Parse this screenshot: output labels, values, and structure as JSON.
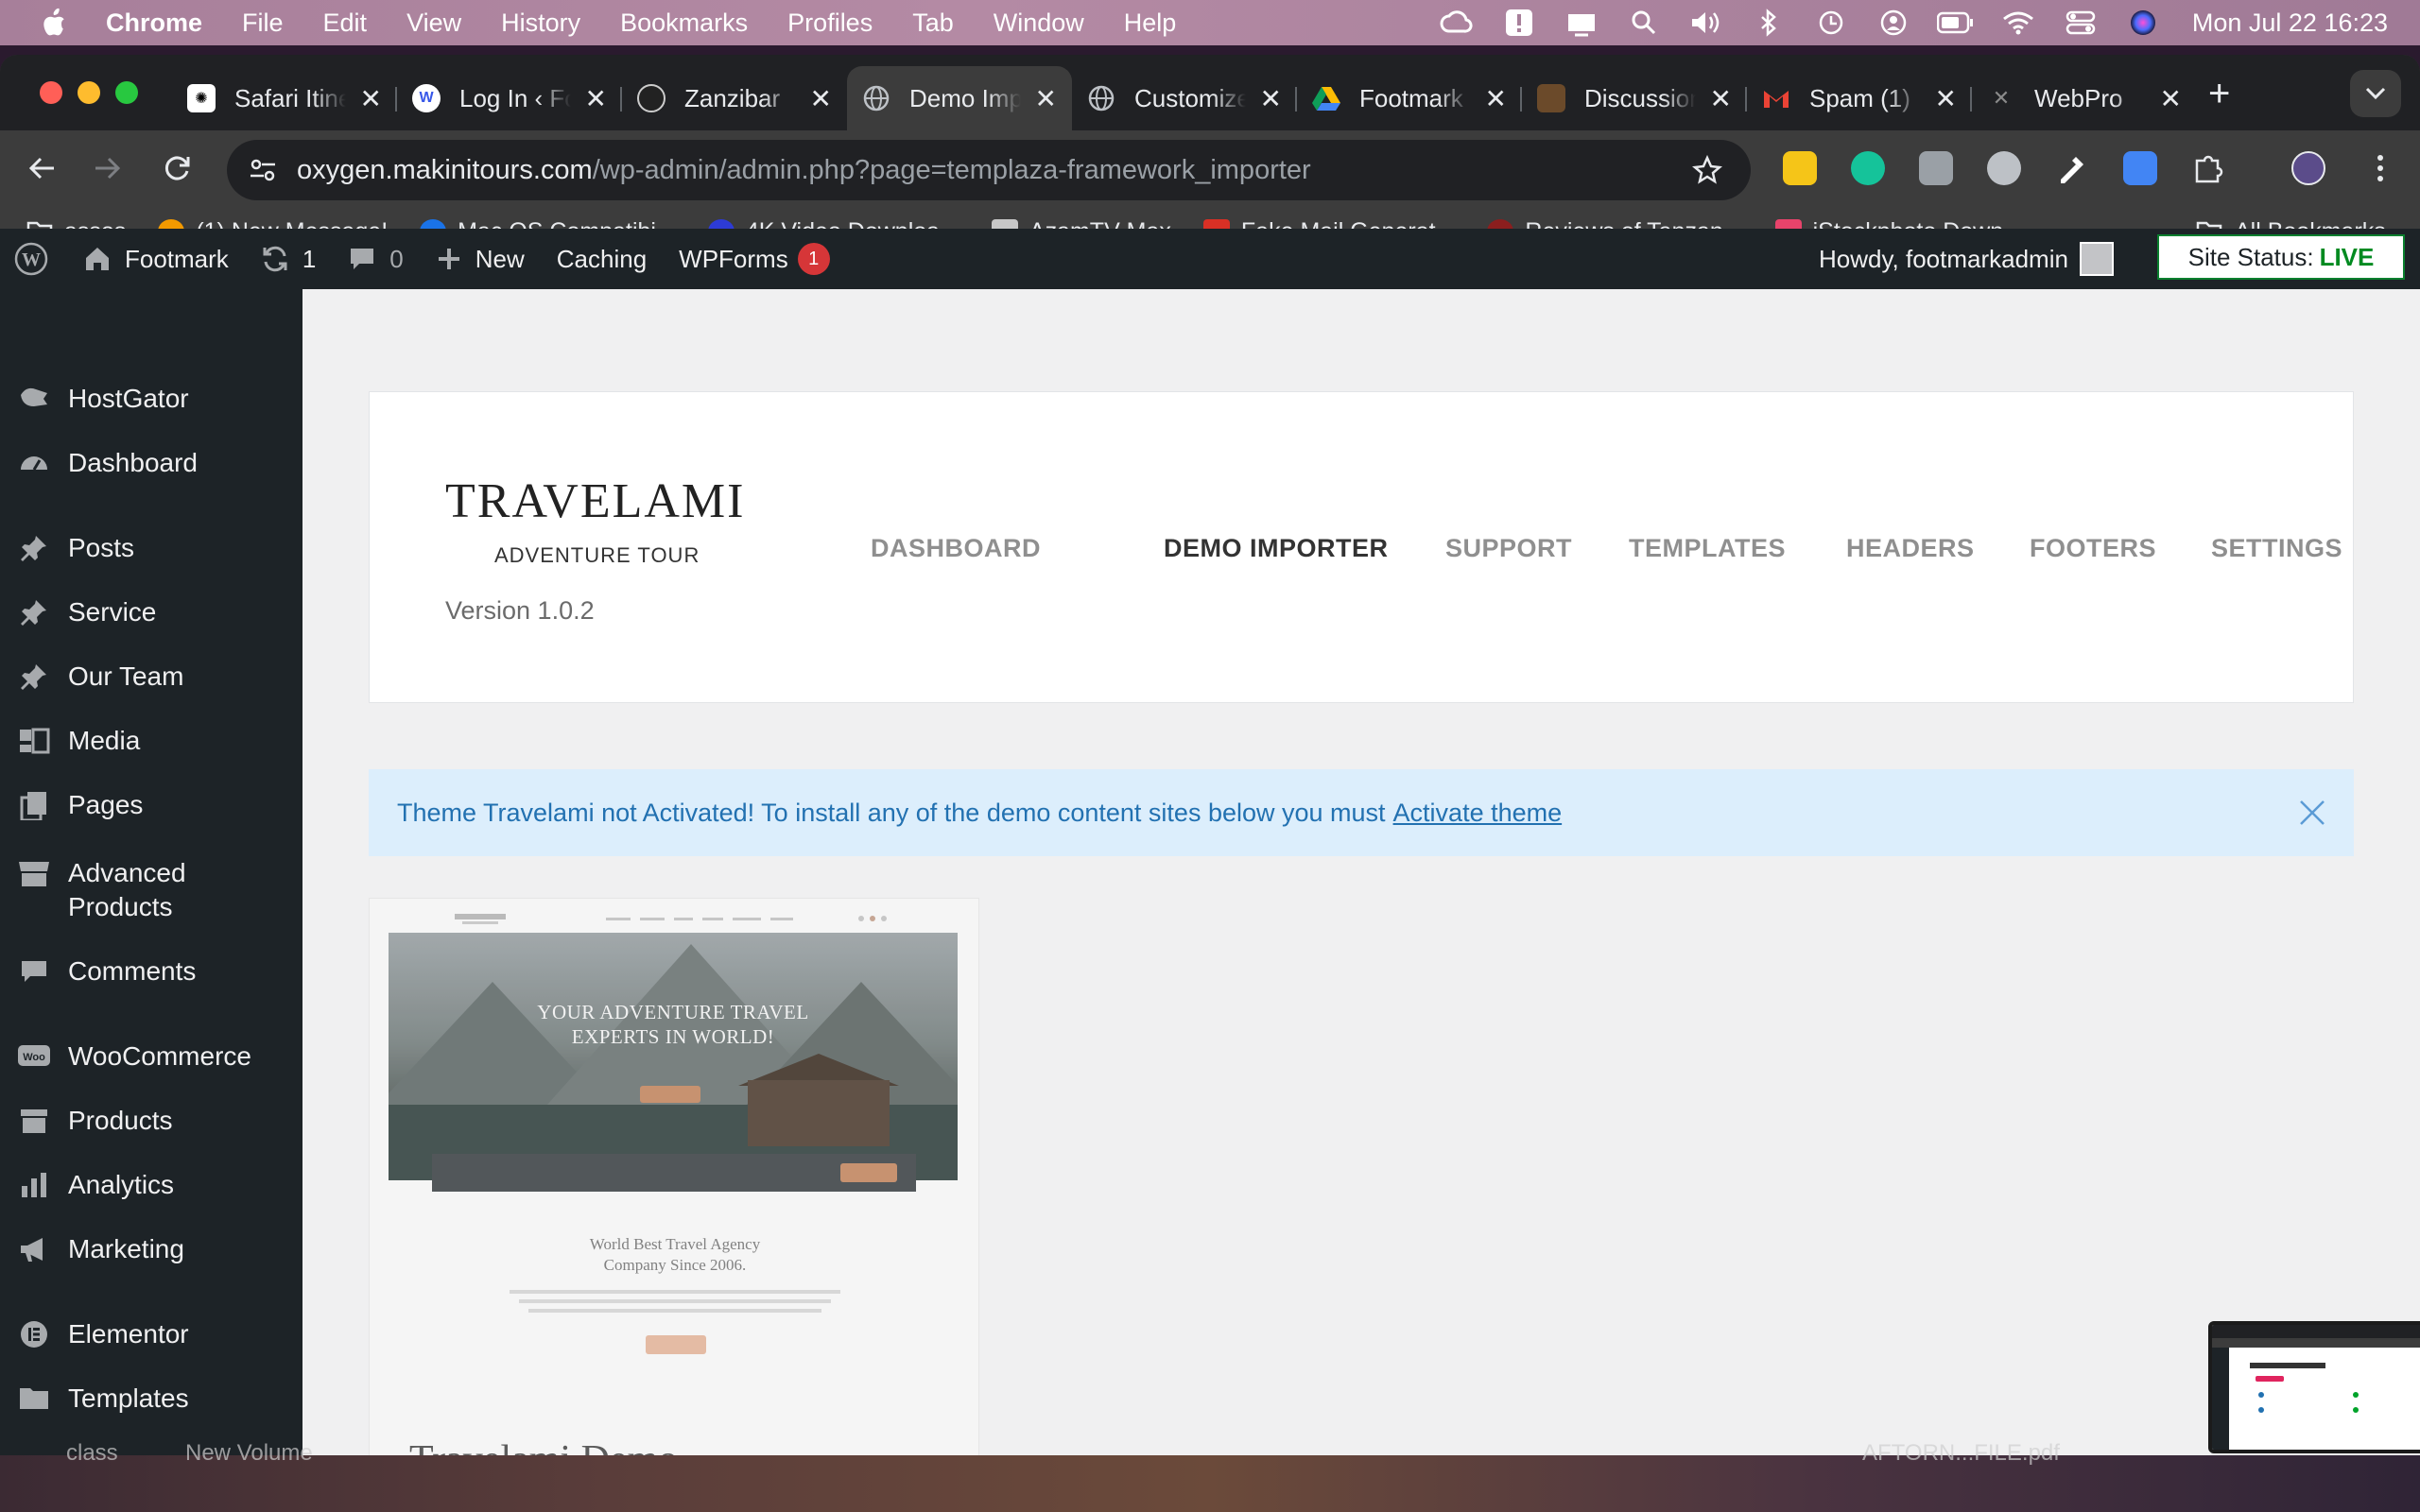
{
  "menubar": {
    "app": "Chrome",
    "items": [
      "File",
      "Edit",
      "View",
      "History",
      "Bookmarks",
      "Profiles",
      "Tab",
      "Window",
      "Help"
    ],
    "clock": "Mon Jul 22  16:23"
  },
  "tabs": [
    {
      "title": "Safari Itinerary",
      "icon": "chatgpt-icon"
    },
    {
      "title": "Log In ‹ Footmark",
      "icon": "wordpress-icon"
    },
    {
      "title": "Zanzibar",
      "icon": "zanzibar-icon"
    },
    {
      "title": "Demo Importer",
      "icon": "globe-icon",
      "active": true
    },
    {
      "title": "Customize",
      "icon": "globe-icon"
    },
    {
      "title": "Footmark",
      "icon": "drive-icon"
    },
    {
      "title": "Discussion",
      "icon": "book-icon"
    },
    {
      "title": "Spam (1)",
      "icon": "gmail-icon"
    },
    {
      "title": "WebPro",
      "icon": "webpro-icon"
    }
  ],
  "url": {
    "host": "oxygen.makinitours.com",
    "path": "/wp-admin/admin.php?page=templaza-framework_importer"
  },
  "bookmarks": [
    {
      "label": "assos",
      "icon": "folder-icon"
    },
    {
      "label": "(1) New Message!",
      "icon": "play-icon"
    },
    {
      "label": "Mac OS Compatibi...",
      "icon": "cloud-icon"
    },
    {
      "label": "4K Video Downloa...",
      "icon": "info-icon"
    },
    {
      "label": "AzamTV Max",
      "icon": "tv-icon"
    },
    {
      "label": "Fake Mail Generat...",
      "icon": "mail-icon"
    },
    {
      "label": "Reviews of Tanzan...",
      "icon": "tripadvisor-icon"
    },
    {
      "label": "iStockphoto Down...",
      "icon": "download-icon"
    }
  ],
  "bookmarks_all": "All Bookmarks",
  "adminbar": {
    "site": "Footmark",
    "updates": "1",
    "comments": "0",
    "new": "New",
    "caching": "Caching",
    "wpforms": "WPForms",
    "wpforms_badge": "1",
    "howdy": "Howdy, footmarkadmin",
    "status_label": "Site Status:",
    "status_value": "LIVE"
  },
  "sidebar": [
    {
      "label": "HostGator",
      "icon": "hostgator-icon"
    },
    {
      "label": "Dashboard",
      "icon": "dashboard-icon"
    },
    {
      "label": "Posts",
      "icon": "pin-icon"
    },
    {
      "label": "Service",
      "icon": "pin-icon"
    },
    {
      "label": "Our Team",
      "icon": "pin-icon"
    },
    {
      "label": "Media",
      "icon": "media-icon"
    },
    {
      "label": "Pages",
      "icon": "pages-icon"
    },
    {
      "label": "Advanced Products",
      "icon": "store-icon"
    },
    {
      "label": "Comments",
      "icon": "comment-icon"
    },
    {
      "label": "WooCommerce",
      "icon": "woo-icon"
    },
    {
      "label": "Products",
      "icon": "archive-icon"
    },
    {
      "label": "Analytics",
      "icon": "chart-icon"
    },
    {
      "label": "Marketing",
      "icon": "megaphone-icon"
    },
    {
      "label": "Elementor",
      "icon": "elementor-icon"
    },
    {
      "label": "Templates",
      "icon": "folder-icon"
    }
  ],
  "panel": {
    "logo_main": "TRAVELAMI",
    "logo_sub": "ADVENTURE TOUR",
    "version": "Version 1.0.2",
    "nav": [
      "DASHBOARD",
      "DEMO IMPORTER",
      "SUPPORT",
      "TEMPLATES",
      "HEADERS",
      "FOOTERS",
      "SETTINGS"
    ],
    "active_nav": "DEMO IMPORTER"
  },
  "notice": {
    "text": "Theme Travelami not Activated! To install any of the demo content sites below you must",
    "link": "Activate theme"
  },
  "demo_card": {
    "hero_title_1": "YOUR ADVENTURE TRAVEL",
    "hero_title_2": "EXPERTS IN WORLD!",
    "sub_1": "World Best Travel Agency",
    "sub_2": "Company Since 2006.",
    "title": "Travelami Demo"
  },
  "desktop": {
    "labels": [
      "class",
      "New Volume",
      "AFTORN...FILE.pdf"
    ]
  },
  "colors": {
    "wp_dark": "#1d2327",
    "notice_bg": "#dceefc",
    "link_blue": "#2271b1",
    "live_green": "#008a20",
    "badge_red": "#d63638"
  }
}
